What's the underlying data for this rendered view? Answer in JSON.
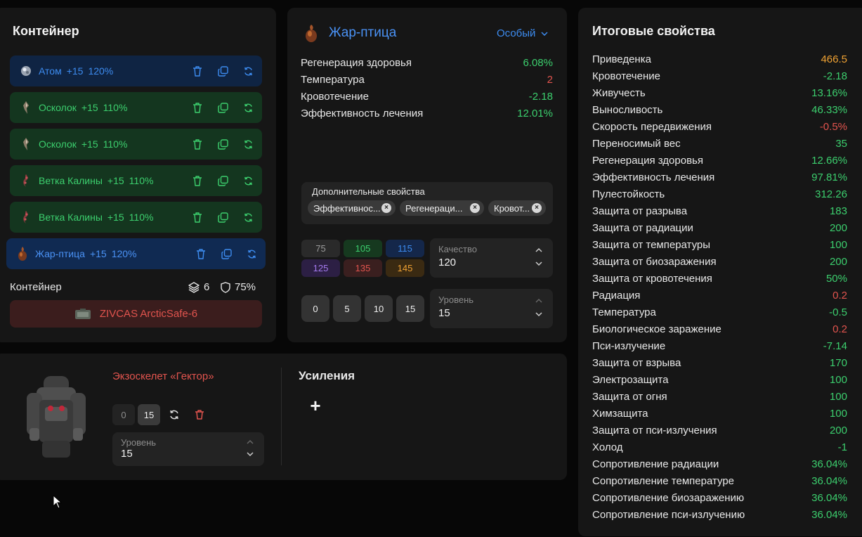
{
  "container": {
    "title": "Контейнер",
    "artifacts": [
      {
        "name": "Атом",
        "bonus": "+15",
        "quality": "120%",
        "color": "blue",
        "icon": "atom-artifact-icon"
      },
      {
        "name": "Осколок",
        "bonus": "+15",
        "quality": "110%",
        "color": "green",
        "icon": "shard-artifact-icon"
      },
      {
        "name": "Осколок",
        "bonus": "+15",
        "quality": "110%",
        "color": "green",
        "icon": "shard-artifact-icon"
      },
      {
        "name": "Ветка Калины",
        "bonus": "+15",
        "quality": "110%",
        "color": "green",
        "icon": "viburnum-branch-artifact-icon"
      },
      {
        "name": "Ветка Калины",
        "bonus": "+15",
        "quality": "110%",
        "color": "green",
        "icon": "viburnum-branch-artifact-icon"
      },
      {
        "name": "Жар-птица",
        "bonus": "+15",
        "quality": "120%",
        "color": "blue",
        "icon": "firebird-artifact-icon"
      }
    ],
    "footer_label": "Контейнер",
    "slots": "6",
    "protection": "75%",
    "selected_container": "ZIVCAS ArcticSafe-6"
  },
  "artifact": {
    "name": "Жар-птица",
    "rarity": "Особый",
    "stats": [
      {
        "label": "Регенерация здоровья",
        "value": "6.08%",
        "tone": "good"
      },
      {
        "label": "Температура",
        "value": "2",
        "tone": "bad"
      },
      {
        "label": "Кровотечение",
        "value": "-2.18",
        "tone": "good"
      },
      {
        "label": "Эффективность лечения",
        "value": "12.01%",
        "tone": "good"
      }
    ],
    "extra_title": "Дополнительные свойства",
    "extra_chips": [
      "Эффективнос...",
      "Регенераци...",
      "Кровот..."
    ],
    "quality_presets": [
      {
        "value": "75",
        "bg": "#2a2a2a",
        "fg": "#9a9a9a"
      },
      {
        "value": "105",
        "bg": "#16391f",
        "fg": "#3ccf6e"
      },
      {
        "value": "115",
        "bg": "#14274a",
        "fg": "#3d8cf0"
      },
      {
        "value": "125",
        "bg": "#2c1f44",
        "fg": "#a57bf0"
      },
      {
        "value": "135",
        "bg": "#3a1f1f",
        "fg": "#e2544e"
      },
      {
        "value": "145",
        "bg": "#3a2a12",
        "fg": "#f0a233"
      }
    ],
    "quality_label": "Качество",
    "quality_value": "120",
    "level_presets": [
      "0",
      "5",
      "10",
      "15"
    ],
    "level_label": "Уровень",
    "level_value": "15"
  },
  "armor": {
    "name": "Экзоскелет «Гектор»",
    "level_buttons": [
      "0",
      "15"
    ],
    "level_label": "Уровень",
    "level_value": "15",
    "boosts_title": "Усиления",
    "add_symbol": "+"
  },
  "totals": {
    "title": "Итоговые свойства",
    "rows": [
      {
        "label": "Приведенка",
        "value": "466.5",
        "tone": "orange"
      },
      {
        "label": "Кровотечение",
        "value": "-2.18",
        "tone": "good"
      },
      {
        "label": "Живучесть",
        "value": "13.16%",
        "tone": "good"
      },
      {
        "label": "Выносливость",
        "value": "46.33%",
        "tone": "good"
      },
      {
        "label": "Скорость передвижения",
        "value": "-0.5%",
        "tone": "bad"
      },
      {
        "label": "Переносимый вес",
        "value": "35",
        "tone": "good"
      },
      {
        "label": "Регенерация здоровья",
        "value": "12.66%",
        "tone": "good"
      },
      {
        "label": "Эффективность лечения",
        "value": "97.81%",
        "tone": "good"
      },
      {
        "label": "Пулестойкость",
        "value": "312.26",
        "tone": "good"
      },
      {
        "label": "Защита от разрыва",
        "value": "183",
        "tone": "good"
      },
      {
        "label": "Защита от радиации",
        "value": "200",
        "tone": "good"
      },
      {
        "label": "Защита от температуры",
        "value": "100",
        "tone": "good"
      },
      {
        "label": "Защита от биозаражения",
        "value": "200",
        "tone": "good"
      },
      {
        "label": "Защита от кровотечения",
        "value": "50%",
        "tone": "good"
      },
      {
        "label": "Радиация",
        "value": "0.2",
        "tone": "bad"
      },
      {
        "label": "Температура",
        "value": "-0.5",
        "tone": "good"
      },
      {
        "label": "Биологическое заражение",
        "value": "0.2",
        "tone": "bad"
      },
      {
        "label": "Пси-излучение",
        "value": "-7.14",
        "tone": "good"
      },
      {
        "label": "Защита от взрыва",
        "value": "170",
        "tone": "good"
      },
      {
        "label": "Электрозащита",
        "value": "100",
        "tone": "good"
      },
      {
        "label": "Защита от огня",
        "value": "100",
        "tone": "good"
      },
      {
        "label": "Химзащита",
        "value": "100",
        "tone": "good"
      },
      {
        "label": "Защита от пси-излучения",
        "value": "200",
        "tone": "good"
      },
      {
        "label": "Холод",
        "value": "-1",
        "tone": "good"
      },
      {
        "label": "Сопротивление радиации",
        "value": "36.04%",
        "tone": "good"
      },
      {
        "label": "Сопротивление температуре",
        "value": "36.04%",
        "tone": "good"
      },
      {
        "label": "Сопротивление биозаражению",
        "value": "36.04%",
        "tone": "good"
      },
      {
        "label": "Сопротивление пси-излучению",
        "value": "36.04%",
        "tone": "good"
      }
    ]
  },
  "colors": {
    "good": "#3ccf6e",
    "bad": "#e2544e",
    "orange": "#f0a233",
    "accent": "#4a92f5"
  }
}
